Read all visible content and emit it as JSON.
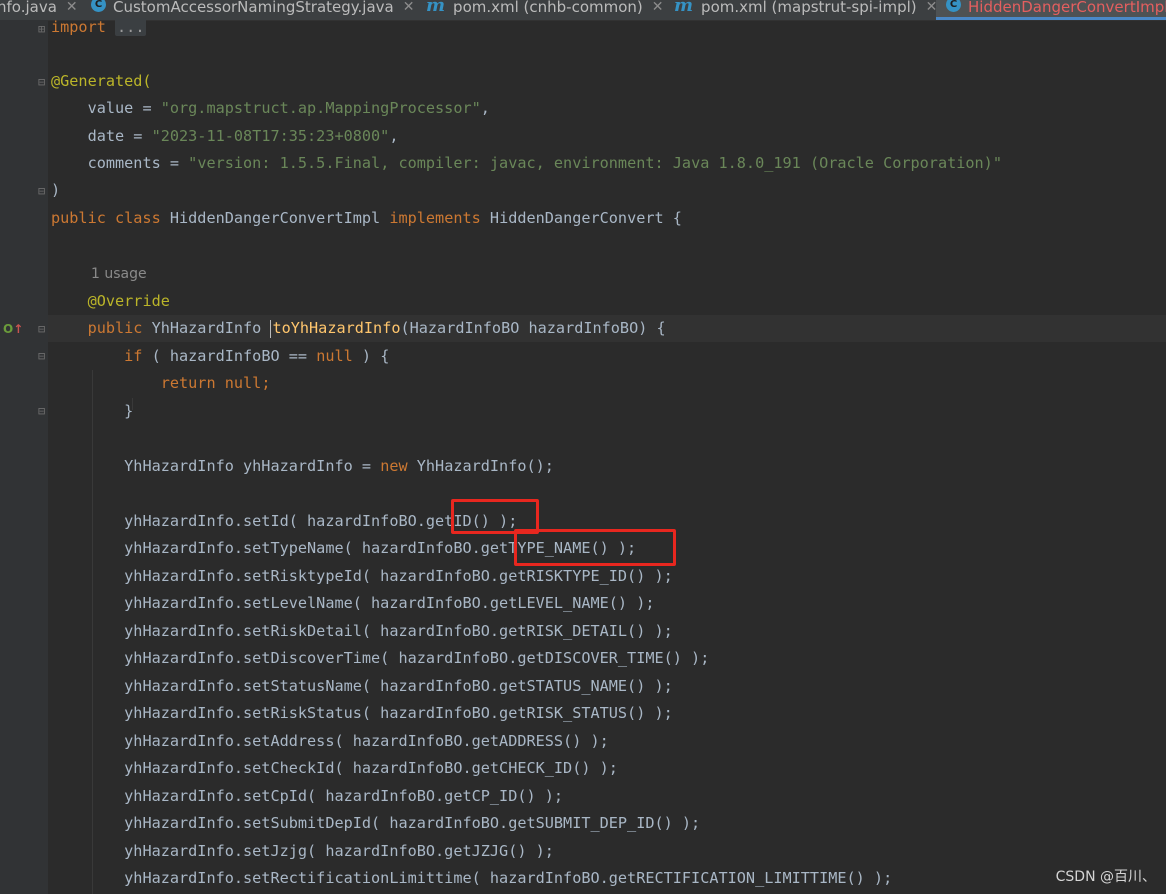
{
  "tabs": [
    {
      "label": "nfo.java",
      "icon": "none",
      "active": false
    },
    {
      "label": "CustomAccessorNamingStrategy.java",
      "icon": "class-icon",
      "active": false
    },
    {
      "label": "pom.xml (cnhb-common)",
      "icon": "maven-icon",
      "active": false
    },
    {
      "label": "pom.xml (mapstrut-spi-impl)",
      "icon": "maven-icon",
      "active": false
    },
    {
      "label": "HiddenDangerConvertImpl",
      "icon": "class-icon",
      "active": true
    }
  ],
  "code": {
    "import_kw": "import",
    "import_fold": "...",
    "generated": "@Generated(",
    "value_key": "value = ",
    "value_str": "\"org.mapstruct.ap.MappingProcessor\"",
    "date_key": "date = ",
    "date_str": "\"2023-11-08T17:35:23+0800\"",
    "comments_key": "comments = ",
    "comments_str": "\"version: 1.5.5.Final, compiler: javac, environment: Java 1.8.0_191 (Oracle Corporation)\"",
    "close_paren": ")",
    "class_public": "public class ",
    "class_name": "HiddenDangerConvertImpl ",
    "class_implements": "implements ",
    "class_iface": "HiddenDangerConvert {",
    "usage_hint": "1 usage",
    "override": "@Override",
    "method_public": "public ",
    "method_return": "YhHazardInfo ",
    "method_name": "toYhHazardInfo",
    "method_params": "(HazardInfoBO hazardInfoBO) {",
    "if_kw": "if ",
    "if_cond_a": "( hazardInfoBO == ",
    "null_kw": "null",
    "if_cond_b": " ) {",
    "return_null": "return null;",
    "close_brace": "}",
    "decl_a": "YhHazardInfo yhHazardInfo = ",
    "new_kw": "new ",
    "decl_b": "YhHazardInfo();",
    "setters": [
      "yhHazardInfo.setId( hazardInfoBO.getID() );",
      "yhHazardInfo.setTypeName( hazardInfoBO.getTYPE_NAME() );",
      "yhHazardInfo.setRisktypeId( hazardInfoBO.getRISKTYPE_ID() );",
      "yhHazardInfo.setLevelName( hazardInfoBO.getLEVEL_NAME() );",
      "yhHazardInfo.setRiskDetail( hazardInfoBO.getRISK_DETAIL() );",
      "yhHazardInfo.setDiscoverTime( hazardInfoBO.getDISCOVER_TIME() );",
      "yhHazardInfo.setStatusName( hazardInfoBO.getSTATUS_NAME() );",
      "yhHazardInfo.setRiskStatus( hazardInfoBO.getRISK_STATUS() );",
      "yhHazardInfo.setAddress( hazardInfoBO.getADDRESS() );",
      "yhHazardInfo.setCheckId( hazardInfoBO.getCHECK_ID() );",
      "yhHazardInfo.setCpId( hazardInfoBO.getCP_ID() );",
      "yhHazardInfo.setSubmitDepId( hazardInfoBO.getSUBMIT_DEP_ID() );",
      "yhHazardInfo.setJzjg( hazardInfoBO.getJZJG() );",
      "yhHazardInfo.setRectificationLimittime( hazardInfoBO.getRECTIFICATION_LIMITTIME() );"
    ]
  },
  "colors": {
    "background": "#2b2b2b",
    "keyword": "#cc7832",
    "string": "#6a8759",
    "annotation": "#bbb529",
    "method_decl": "#ffc66d",
    "highlight_box": "#e8271f"
  },
  "watermark": "CSDN @百川、"
}
